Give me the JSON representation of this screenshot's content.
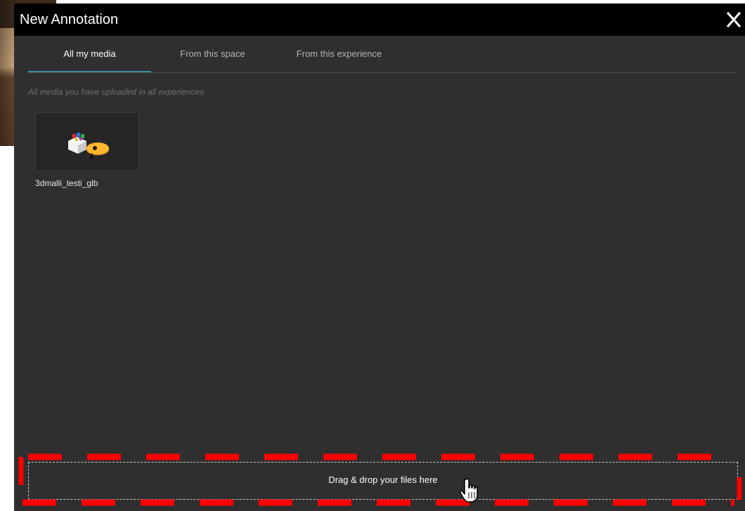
{
  "dialog": {
    "title": "New Annotation",
    "close_icon": "close-icon"
  },
  "tabs": [
    {
      "label": "All my media",
      "active": true
    },
    {
      "label": "From this space",
      "active": false
    },
    {
      "label": "From this experience",
      "active": false
    }
  ],
  "subtitle": "All media you have uploaded in all experiences",
  "media": [
    {
      "name": "3dmalli_testi_glb",
      "thumbnail_icon": "3d-model-thumbnail-icon"
    }
  ],
  "dropzone": {
    "label": "Drag & drop your files here"
  },
  "colors": {
    "accent": "#3d8fa6",
    "highlight": "#ff0000",
    "panel": "#2f2f2f",
    "titlebar": "#000000"
  }
}
